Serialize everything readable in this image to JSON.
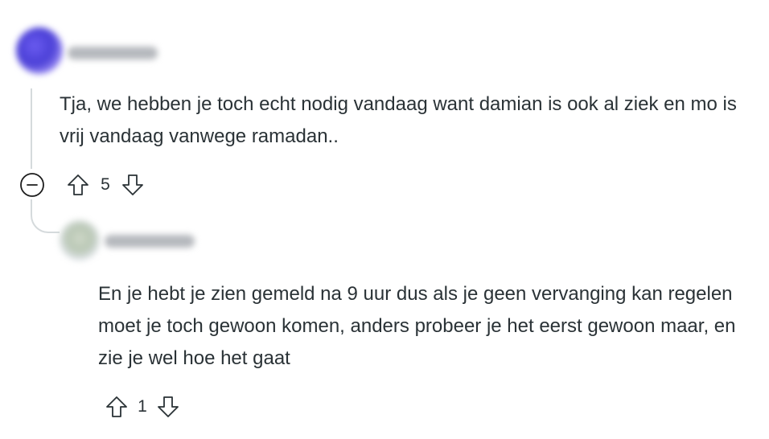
{
  "comments": [
    {
      "text": "Tja, we hebben je toch echt nodig vandaag want damian is ook al ziek en mo is vrij vandaag vanwege ramadan..",
      "score": "5",
      "avatar_color": "#4a3fd6"
    },
    {
      "text": "En je hebt je zien gemeld na 9 uur dus als je geen vervanging kan regelen moet je toch gewoon komen, anders probeer je het eerst gewoon maar, en zie je wel hoe het gaat",
      "score": "1",
      "avatar_color": "#b9c7b4"
    }
  ],
  "icons": {
    "collapse": "minus-circle-icon",
    "upvote": "arrow-up-outline-icon",
    "downvote": "arrow-down-outline-icon"
  },
  "colors": {
    "text": "#2a3236",
    "thread_line": "#d5dadc"
  }
}
